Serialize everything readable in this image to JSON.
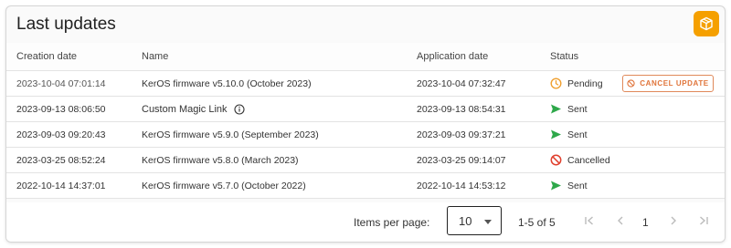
{
  "card": {
    "title": "Last updates",
    "icon": "package-icon",
    "accent": "#f5a000"
  },
  "table": {
    "columns": [
      "Creation date",
      "Name",
      "Application date",
      "Status"
    ],
    "rows": [
      {
        "creation": "2023-10-04 07:01:14",
        "name": "KerOS firmware v5.10.0 (October 2023)",
        "application": "2023-10-04 07:32:47",
        "status": "Pending",
        "status_icon": "clock-icon",
        "action": "CANCEL UPDATE"
      },
      {
        "creation": "2023-09-13 08:06:50",
        "name": "Custom Magic Link",
        "application": "2023-09-13 08:54:31",
        "status": "Sent",
        "status_icon": "send-icon"
      },
      {
        "creation": "2023-09-03 09:20:43",
        "name": "KerOS firmware v5.9.0 (September 2023)",
        "application": "2023-09-03 09:37:21",
        "status": "Sent",
        "status_icon": "send-icon"
      },
      {
        "creation": "2023-03-25 08:52:24",
        "name": "KerOS firmware v5.8.0 (March 2023)",
        "application": "2023-03-25 09:14:07",
        "status": "Cancelled",
        "status_icon": "ban-icon"
      },
      {
        "creation": "2022-10-14 14:37:01",
        "name": "KerOS firmware v5.7.0 (October 2022)",
        "application": "2022-10-14 14:53:12",
        "status": "Sent",
        "status_icon": "send-icon"
      }
    ]
  },
  "pagination": {
    "items_per_page_label": "Items per page:",
    "items_per_page": "10",
    "range": "1-5 of 5",
    "current_page": "1"
  },
  "colors": {
    "pending": "#f0a030",
    "sent": "#2ea84a",
    "cancelled": "#e0412f",
    "cancel_button": "#e0743a"
  }
}
